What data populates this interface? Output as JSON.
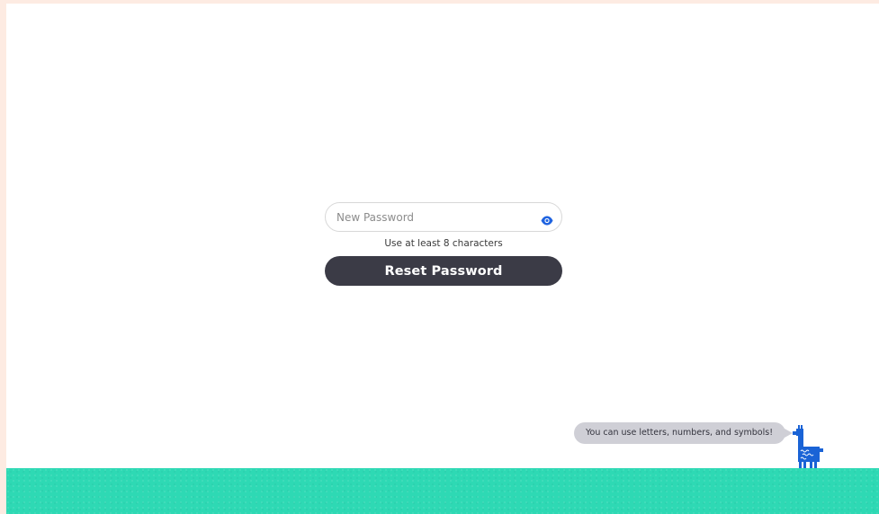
{
  "form": {
    "password_placeholder": "New Password",
    "password_value": "",
    "hint": "Use at least 8 characters",
    "submit_label": "Reset Password"
  },
  "mascot": {
    "speech": "You can use letters, numbers, and symbols!"
  },
  "colors": {
    "page_border": "#fdebe2",
    "button": "#3b3b46",
    "eye_icon": "#1f63e0",
    "ground": "#2ed9b4",
    "llama": "#1a63d6",
    "bubble": "#cfcfd6"
  },
  "icons": {
    "visibility_toggle": "eye-icon",
    "mascot": "llama-icon"
  }
}
